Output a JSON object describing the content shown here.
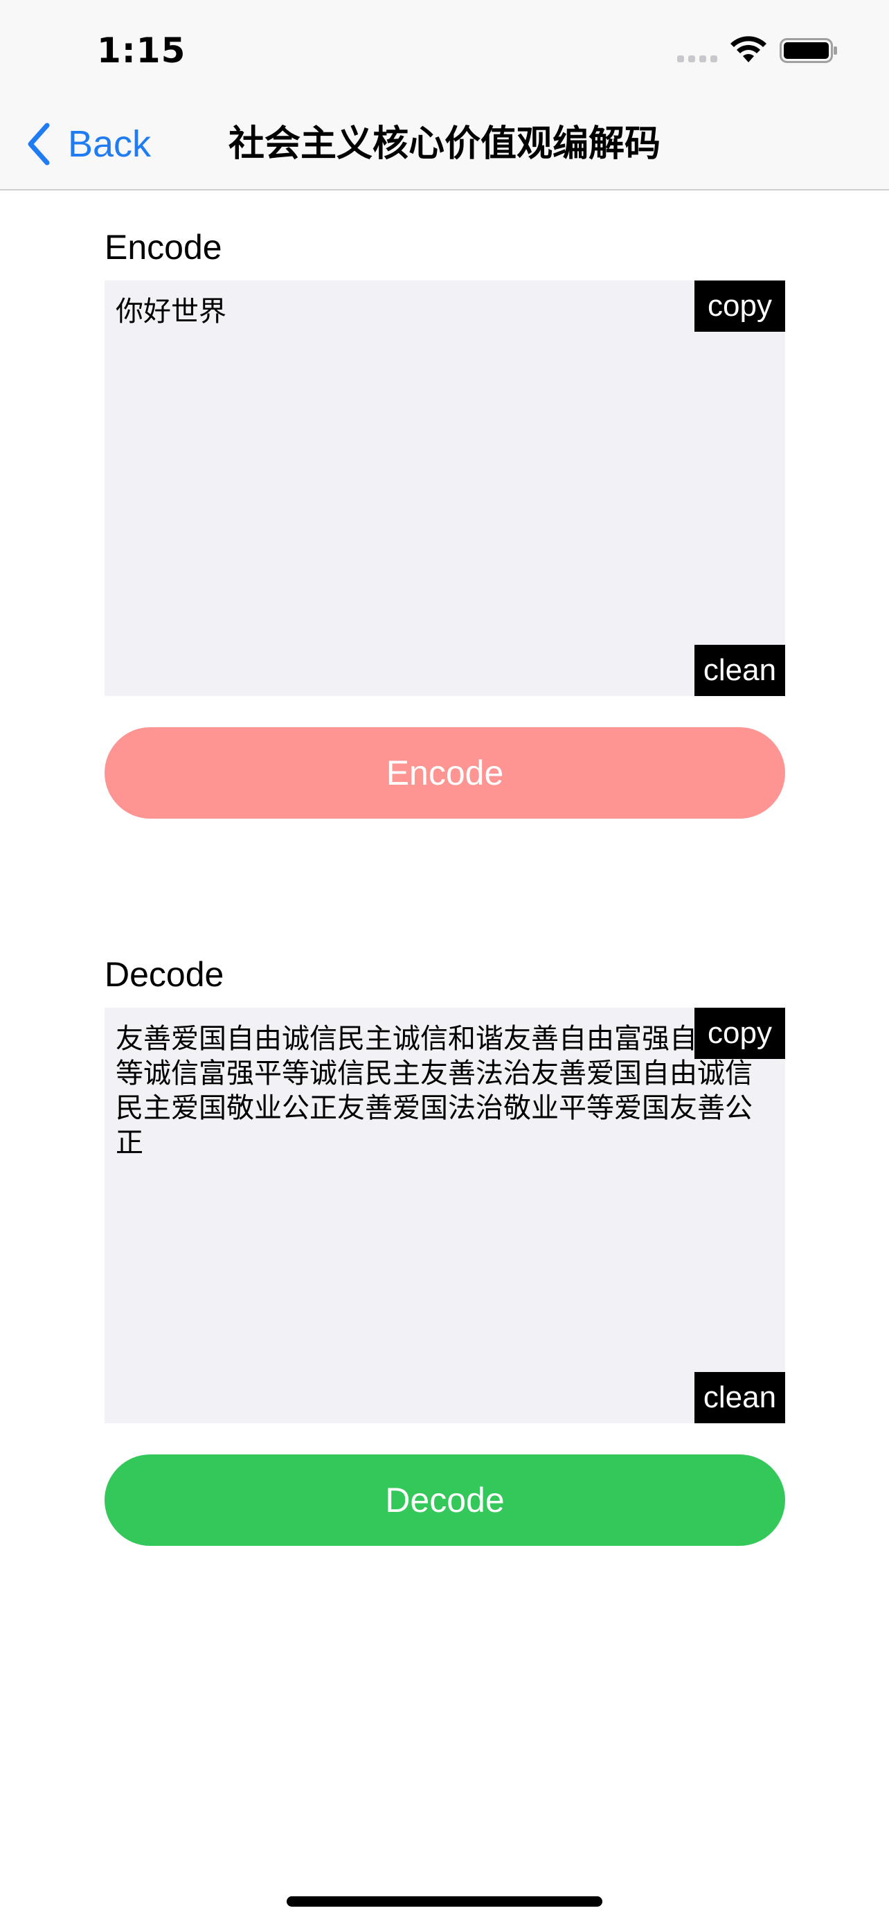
{
  "status_bar": {
    "time": "1:15",
    "icons": [
      "signal-icon",
      "wifi-icon",
      "battery-icon"
    ]
  },
  "nav": {
    "back_label": "Back",
    "title": "社会主义核心价值观编解码"
  },
  "encode": {
    "label": "Encode",
    "text": "你好世界",
    "copy_label": "copy",
    "clean_label": "clean",
    "button_label": "Encode",
    "button_color": "#ff9593"
  },
  "decode": {
    "label": "Decode",
    "text": "友善爱国自由诚信民主诚信和谐友善自由富强自由平等诚信富强平等诚信民主友善法治友善爱国自由诚信民主爱国敬业公正友善爱国法治敬业平等爱国友善公正",
    "copy_label": "copy",
    "clean_label": "clean",
    "button_label": "Decode",
    "button_color": "#34c759"
  },
  "colors": {
    "accent": "#1f7cf2",
    "textbox_bg": "#f2f2f6",
    "bar_bg": "#f8f8f8"
  }
}
